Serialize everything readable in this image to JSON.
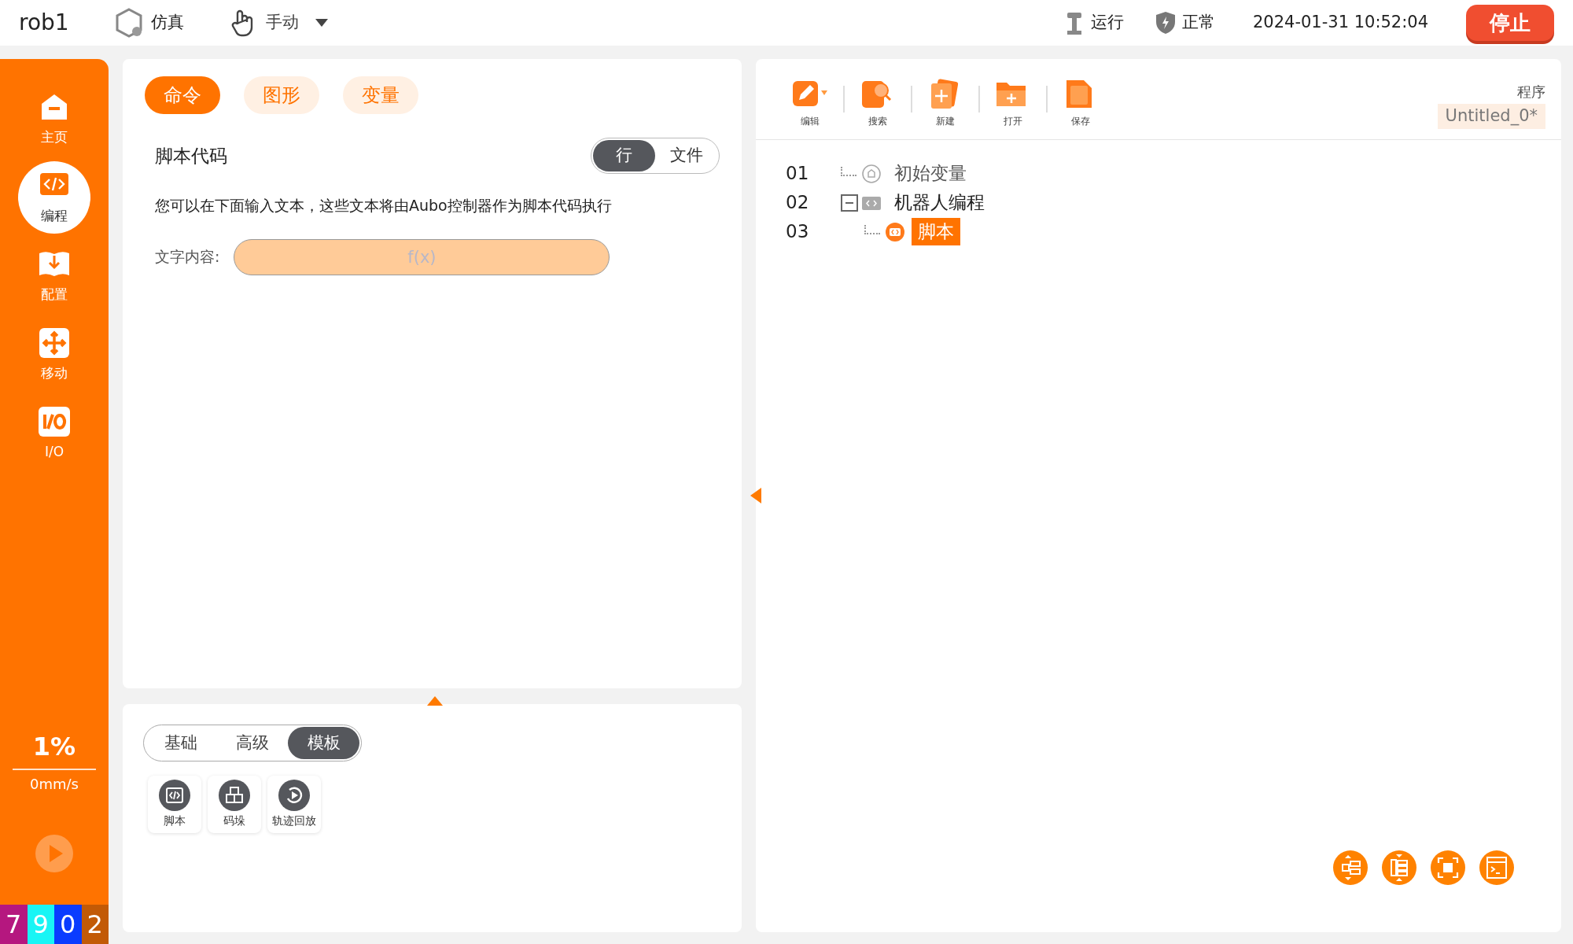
{
  "header": {
    "robot": "rob1",
    "mode": "仿真",
    "control": "手动",
    "run_state": "运行",
    "health": "正常",
    "datetime": "2024-01-31 10:52:04",
    "stop": "停止"
  },
  "sidebar": {
    "items": [
      {
        "label": "主页",
        "selected": false
      },
      {
        "label": "编程",
        "selected": true
      },
      {
        "label": "配置",
        "selected": false
      },
      {
        "label": "移动",
        "selected": false
      },
      {
        "label": "I/O",
        "selected": false
      }
    ],
    "speed_percent": "1%",
    "speed": "0mm/s",
    "counters": [
      {
        "digit": "7",
        "color": "#b5177f"
      },
      {
        "digit": "9",
        "color": "#19f5f5"
      },
      {
        "digit": "0",
        "color": "#0a3cff"
      },
      {
        "digit": "2",
        "color": "#c25a06"
      }
    ]
  },
  "command_tabs": [
    {
      "label": "命令",
      "selected": true
    },
    {
      "label": "图形",
      "selected": false
    },
    {
      "label": "变量",
      "selected": false
    }
  ],
  "script": {
    "title": "脚本代码",
    "modes": [
      {
        "label": "行",
        "selected": true
      },
      {
        "label": "文件",
        "selected": false
      }
    ],
    "description": "您可以在下面输入文本，这些文本将由Aubo控制器作为脚本代码执行",
    "field_label": "文字内容:",
    "placeholder": "f(x)"
  },
  "palette": {
    "tabs": [
      {
        "label": "基础",
        "selected": false
      },
      {
        "label": "高级",
        "selected": false
      },
      {
        "label": "模板",
        "selected": true
      }
    ],
    "items": [
      {
        "label": "脚本"
      },
      {
        "label": "码垛"
      },
      {
        "label": "轨迹回放"
      }
    ]
  },
  "toolbar": {
    "buttons": [
      {
        "label": "编辑"
      },
      {
        "label": "搜索"
      },
      {
        "label": "新建"
      },
      {
        "label": "打开"
      },
      {
        "label": "保存"
      }
    ],
    "program_label": "程序",
    "program_name": "Untitled_0*"
  },
  "tree": [
    {
      "line": "01",
      "label": "初始变量",
      "selected": false
    },
    {
      "line": "02",
      "label": "机器人编程",
      "selected": false,
      "expanded": true,
      "children": [
        {
          "line": "03",
          "label": "脚本",
          "selected": true
        }
      ]
    }
  ]
}
